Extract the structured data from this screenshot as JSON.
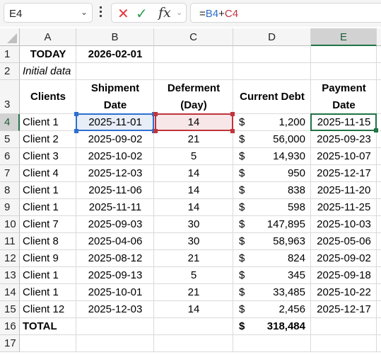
{
  "formula_bar": {
    "name_box": "E4",
    "cancel_icon": "✕",
    "enter_icon": "✓",
    "fx_label": "fx",
    "formula_prefix": "=",
    "formula_ref1": "B4",
    "formula_op": "+",
    "formula_ref2": "C4"
  },
  "columns": [
    "A",
    "B",
    "C",
    "D",
    "E"
  ],
  "selected_column": "E",
  "selected_row": "4",
  "rows": [
    "1",
    "2",
    "3",
    "4",
    "5",
    "6",
    "7",
    "8",
    "9",
    "10",
    "11",
    "12",
    "13",
    "14",
    "15",
    "16",
    "17"
  ],
  "sheet": {
    "today_label": "TODAY",
    "today_value": "2026-02-01",
    "initial_data_label": "Initial data",
    "headers": {
      "clients": "Clients",
      "shipment_line1": "Shipment",
      "shipment_line2": "Date",
      "deferment_line1": "Deferment",
      "deferment_line2": "(Day)",
      "debt": "Current Debt",
      "payment_line1": "Payment",
      "payment_line2": "Date"
    },
    "currency_symbol": "$",
    "data": [
      {
        "client": "Client 1",
        "shipment": "2025-11-01",
        "deferment": "14",
        "debt": "1,200",
        "payment": "2025-11-15"
      },
      {
        "client": "Client 2",
        "shipment": "2025-09-02",
        "deferment": "21",
        "debt": "56,000",
        "payment": "2025-09-23"
      },
      {
        "client": "Client 3",
        "shipment": "2025-10-02",
        "deferment": "5",
        "debt": "14,930",
        "payment": "2025-10-07"
      },
      {
        "client": "Client 4",
        "shipment": "2025-12-03",
        "deferment": "14",
        "debt": "950",
        "payment": "2025-12-17"
      },
      {
        "client": "Client 1",
        "shipment": "2025-11-06",
        "deferment": "14",
        "debt": "838",
        "payment": "2025-11-20"
      },
      {
        "client": "Client 1",
        "shipment": "2025-11-11",
        "deferment": "14",
        "debt": "598",
        "payment": "2025-11-25"
      },
      {
        "client": "Client 7",
        "shipment": "2025-09-03",
        "deferment": "30",
        "debt": "147,895",
        "payment": "2025-10-03"
      },
      {
        "client": "Client 8",
        "shipment": "2025-04-06",
        "deferment": "30",
        "debt": "58,963",
        "payment": "2025-05-06"
      },
      {
        "client": "Client 9",
        "shipment": "2025-08-12",
        "deferment": "21",
        "debt": "824",
        "payment": "2025-09-02"
      },
      {
        "client": "Client 1",
        "shipment": "2025-09-13",
        "deferment": "5",
        "debt": "345",
        "payment": "2025-09-18"
      },
      {
        "client": "Client 1",
        "shipment": "2025-10-01",
        "deferment": "21",
        "debt": "33,485",
        "payment": "2025-10-22"
      },
      {
        "client": "Client 12",
        "shipment": "2025-12-03",
        "deferment": "14",
        "debt": "2,456",
        "payment": "2025-12-17"
      }
    ],
    "total_label": "TOTAL",
    "total_value": "318,484"
  },
  "colors": {
    "accent_green": "#217346",
    "ref_blue": "#2e6fcf",
    "ref_red": "#c0343c"
  }
}
